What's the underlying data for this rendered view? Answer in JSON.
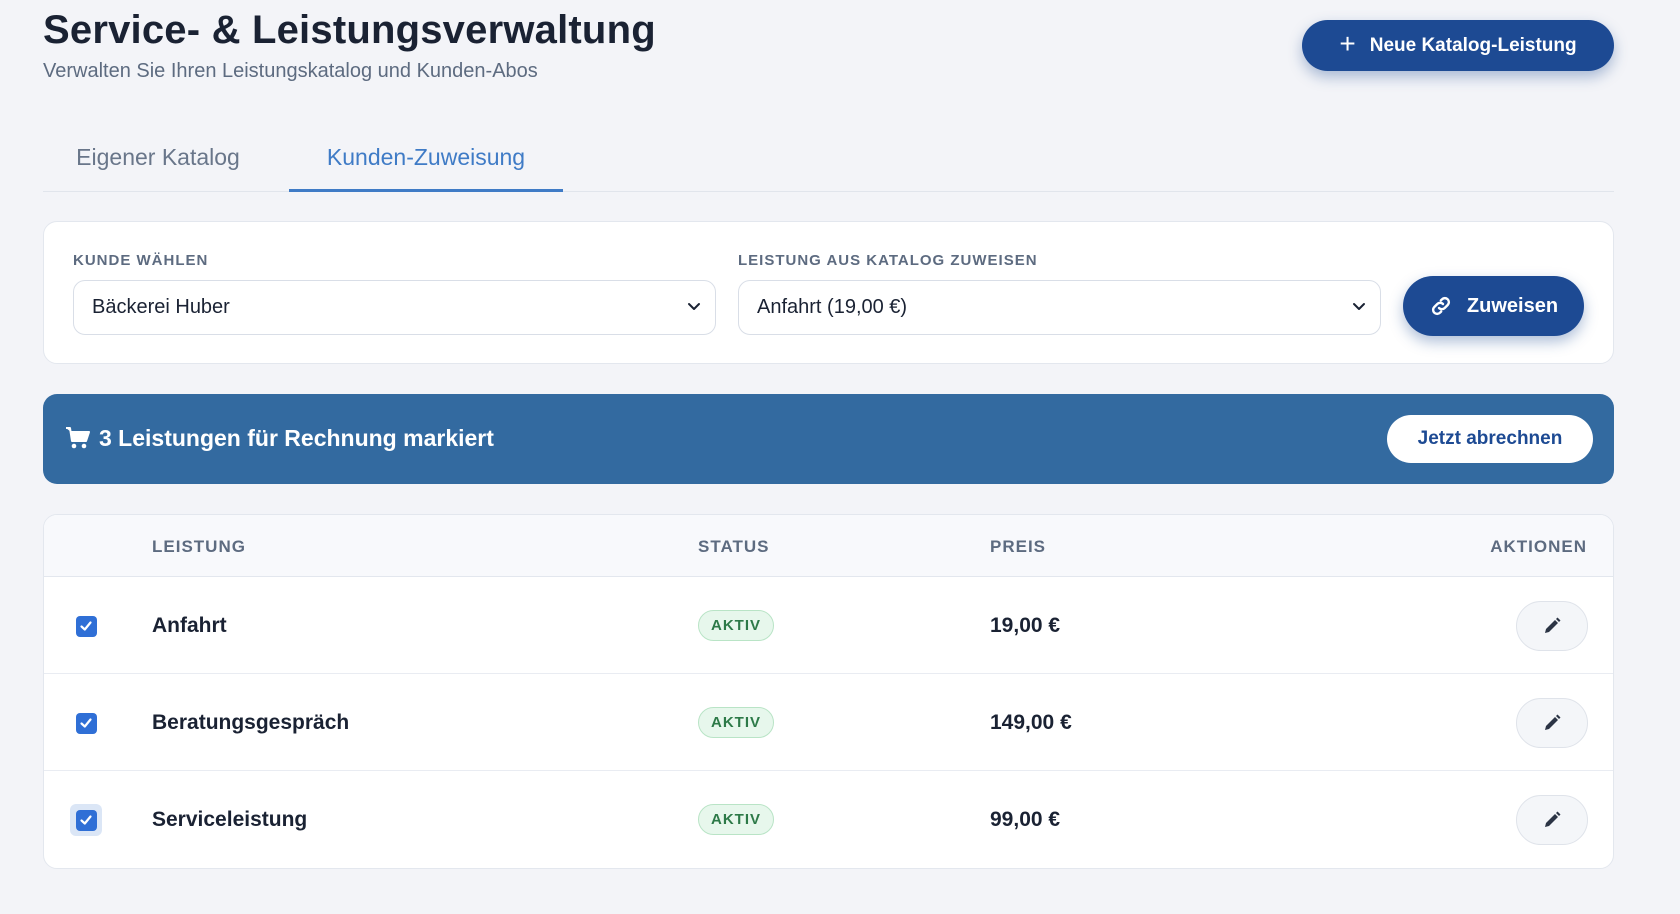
{
  "header": {
    "title": "Service- & Leistungsverwaltung",
    "subtitle": "Verwalten Sie Ihren Leistungskatalog und Kunden-Abos",
    "new_button_label": "Neue Katalog-Leistung"
  },
  "tabs": [
    {
      "label": "Eigener Katalog",
      "active": false
    },
    {
      "label": "Kunden-Zuweisung",
      "active": true
    }
  ],
  "filter": {
    "customer_label": "KUNDE WÄHLEN",
    "customer_value": "Bäckerei Huber",
    "service_label": "LEISTUNG AUS KATALOG ZUWEISEN",
    "service_value": "Anfahrt (19,00 €)",
    "assign_button_label": "Zuweisen"
  },
  "banner": {
    "text": "3 Leistungen für Rechnung markiert",
    "button_label": "Jetzt abrechnen"
  },
  "table": {
    "columns": [
      "LEISTUNG",
      "STATUS",
      "PREIS",
      "AKTIONEN"
    ],
    "rows": [
      {
        "name": "Anfahrt",
        "status": "AKTIV",
        "price": "19,00 €",
        "checked": true
      },
      {
        "name": "Beratungsgespräch",
        "status": "AKTIV",
        "price": "149,00 €",
        "checked": true
      },
      {
        "name": "Serviceleistung",
        "status": "AKTIV",
        "price": "99,00 €",
        "checked": true
      }
    ]
  },
  "colors": {
    "primary": "#1d4a93",
    "accent_tab": "#3f7bc6",
    "banner": "#336aa0",
    "badge_text": "#2d7a48",
    "checkbox": "#2f6fd6"
  },
  "icons": {
    "new_button": "plus-icon",
    "assign_button": "link-icon",
    "banner": "cart-icon",
    "row_action": "pencil-icon",
    "select": "chevron-down-icon"
  }
}
